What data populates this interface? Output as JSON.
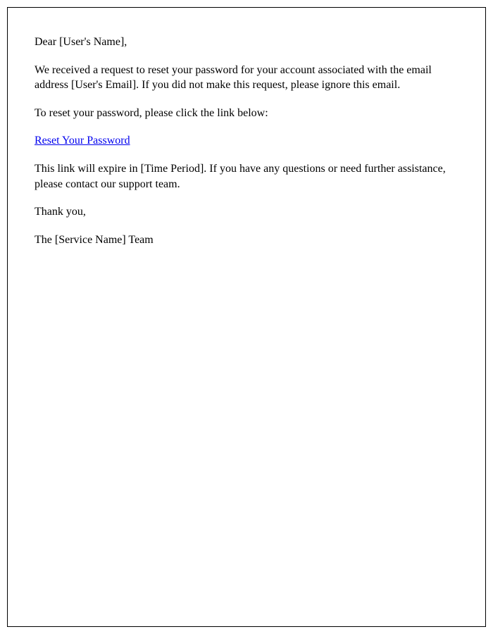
{
  "email": {
    "greeting": "Dear [User's Name],",
    "intro": "We received a request to reset your password for your account associated with the email address [User's Email]. If you did not make this request, please ignore this email.",
    "instruction": "To reset your password, please click the link below:",
    "reset_link_text": "Reset Your Password",
    "expiry_notice": "This link will expire in [Time Period]. If you have any questions or need further assistance, please contact our support team.",
    "thanks": "Thank you,",
    "signature": "The [Service Name] Team"
  }
}
